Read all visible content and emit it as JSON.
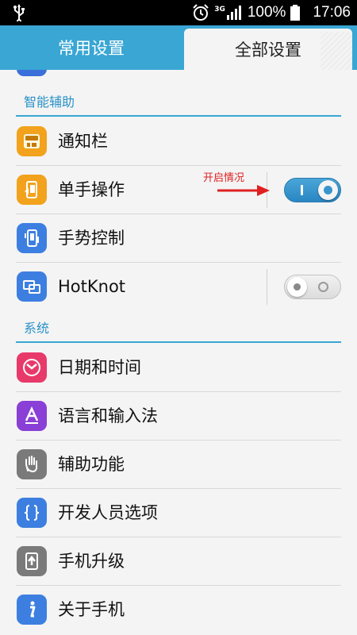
{
  "status_bar": {
    "network": "3G",
    "battery": "100%",
    "time": "17:06",
    "icons": [
      "usb-icon",
      "alarm-icon",
      "signal-icon",
      "battery-icon"
    ]
  },
  "tabs": {
    "common": "常用设置",
    "all": "全部设置",
    "active": "all"
  },
  "sections": [
    {
      "title": "智能辅助",
      "items": [
        {
          "label": "通知栏",
          "icon": "notification-bar-icon",
          "color": "#f2a21c"
        },
        {
          "label": "单手操作",
          "icon": "one-hand-icon",
          "color": "#f2a21c",
          "toggle": true
        },
        {
          "label": "手势控制",
          "icon": "gesture-icon",
          "color": "#3d7fe0"
        },
        {
          "label": "HotKnot",
          "icon": "hotknot-icon",
          "color": "#3d7fe0",
          "toggle": false
        }
      ]
    },
    {
      "title": "系统",
      "items": [
        {
          "label": "日期和时间",
          "icon": "clock-icon",
          "color": "#e83a6a"
        },
        {
          "label": "语言和输入法",
          "icon": "language-icon",
          "color": "#8a3fd6"
        },
        {
          "label": "辅助功能",
          "icon": "hand-icon",
          "color": "#7a7a7a"
        },
        {
          "label": "开发人员选项",
          "icon": "braces-icon",
          "color": "#3d7fe0"
        },
        {
          "label": "手机升级",
          "icon": "upgrade-icon",
          "color": "#7a7a7a"
        },
        {
          "label": "关于手机",
          "icon": "info-icon",
          "color": "#3d7fe0"
        }
      ]
    }
  ],
  "annotation": {
    "text": "开启情况",
    "color": "#e02020"
  },
  "colors": {
    "accent": "#39a6d4",
    "toggle_on": "#3a95cc"
  }
}
